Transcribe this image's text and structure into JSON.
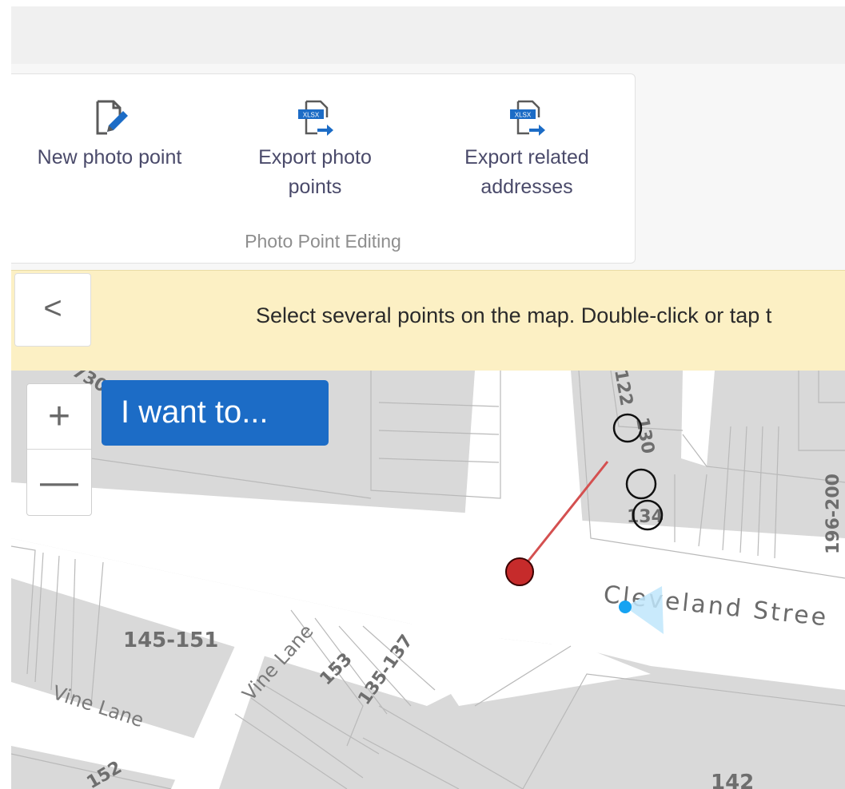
{
  "ribbon": {
    "buttons": [
      {
        "label": "New photo point",
        "icon": "edit-document-icon"
      },
      {
        "label": "Export photo points",
        "label_lines": [
          "Export photo",
          "points"
        ],
        "icon": "xlsx-export-icon"
      },
      {
        "label": "Export related addresses",
        "label_lines": [
          "Export related",
          "addresses"
        ],
        "icon": "xlsx-export-icon"
      }
    ],
    "group_caption": "Photo Point Editing"
  },
  "banner": {
    "back_icon": "chevron-left-icon",
    "back_glyph": "<",
    "message": "Select several points on the map. Double-click or tap t"
  },
  "map": {
    "zoom_in": "+",
    "zoom_out": "—",
    "iwant": "I want to...",
    "labels": {
      "street1": "Cleveland Stree",
      "street2": "Vine Lane",
      "street3": "Vine Lane",
      "lot1": "145-151",
      "lot2": "153",
      "lot3": "135-137",
      "lot4": "196-200",
      "lot5": "142",
      "lot6": "122",
      "lot7": "130",
      "lot8": "134",
      "lot9": "152",
      "lot10": "730"
    },
    "colors": {
      "parcel": "#d9d9d9",
      "street": "#ffffff",
      "selection_point": "#c62b2b",
      "location_dot": "#16a3f2"
    }
  },
  "icons": {
    "xlsx_badge": "XLSX"
  }
}
